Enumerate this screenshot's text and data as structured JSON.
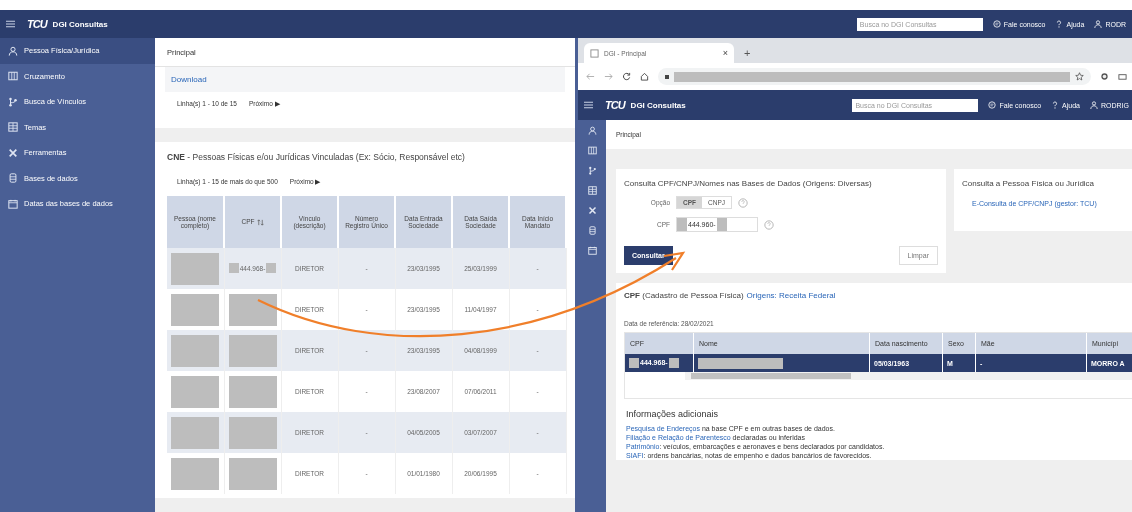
{
  "topbar": {
    "logo": "TCU",
    "app_title": "DGI Consultas",
    "search": {
      "placeholder": "Busca no DGI Consultas"
    },
    "links": [
      {
        "kind": "contact",
        "label": "Fale conosco"
      },
      {
        "kind": "help",
        "label": "Ajuda"
      },
      {
        "kind": "user",
        "label": "RODR"
      }
    ]
  },
  "sidebar": {
    "items": [
      {
        "label": "Pessoa Física/Jurídica",
        "selected": true
      },
      {
        "label": "Cruzamento",
        "selected": false
      },
      {
        "label": "Busca de Vínculos",
        "selected": false
      },
      {
        "label": "Temas",
        "selected": false
      },
      {
        "label": "Ferramentas",
        "selected": false
      },
      {
        "label": "Bases de dados",
        "selected": false
      },
      {
        "label": "Datas das bases de dados",
        "selected": false
      }
    ]
  },
  "main": {
    "breadcrumb": "Principal",
    "download": "Download",
    "pagination": {
      "text": "Linha(s) 1 - 10 de 15",
      "next": "Próximo ▶"
    },
    "cne": {
      "title": "**CNE** - Pessoas Físicas e/ou Jurídicas Vinculadas (Ex: Sócio, Responsável etc)",
      "pagination": {
        "text": "Linha(s) 1 - 15 de mais do que 500",
        "next": "Próximo ▶"
      },
      "columns": [
        {
          "label": "Pessoa (nome completo)",
          "sortable": false
        },
        {
          "label": "CPF",
          "sortable": true
        },
        {
          "label": "Vínculo (descrição)",
          "sortable": false
        },
        {
          "label": "Número Registro Único",
          "sortable": false
        },
        {
          "label": "Data Entrada Sociedade",
          "sortable": false
        },
        {
          "label": "Data Saída Sociedade",
          "sortable": false
        },
        {
          "label": "Data Início Mandato",
          "sortable": false
        }
      ],
      "rows": [
        {
          "cells": [
            {
              "kind": "redacted"
            },
            {
              "kind": "partial",
              "text": "444.968-"
            },
            {
              "kind": "text",
              "text": "DIRETOR"
            },
            {
              "kind": "text",
              "text": "-"
            },
            {
              "kind": "text",
              "text": "23/03/1995"
            },
            {
              "kind": "text",
              "text": "25/03/1999"
            },
            {
              "kind": "text",
              "text": "-"
            }
          ]
        },
        {
          "cells": [
            {
              "kind": "redacted"
            },
            {
              "kind": "redacted"
            },
            {
              "kind": "text",
              "text": "DIRETOR"
            },
            {
              "kind": "text",
              "text": "-"
            },
            {
              "kind": "text",
              "text": "23/03/1995"
            },
            {
              "kind": "text",
              "text": "11/04/1997"
            },
            {
              "kind": "text",
              "text": "-"
            }
          ]
        },
        {
          "cells": [
            {
              "kind": "redacted"
            },
            {
              "kind": "redacted"
            },
            {
              "kind": "text",
              "text": "DIRETOR"
            },
            {
              "kind": "text",
              "text": "-"
            },
            {
              "kind": "text",
              "text": "23/03/1995"
            },
            {
              "kind": "text",
              "text": "04/08/1999"
            },
            {
              "kind": "text",
              "text": "-"
            }
          ]
        },
        {
          "cells": [
            {
              "kind": "redacted"
            },
            {
              "kind": "redacted"
            },
            {
              "kind": "text",
              "text": "DIRETOR"
            },
            {
              "kind": "text",
              "text": "-"
            },
            {
              "kind": "text",
              "text": "23/08/2007"
            },
            {
              "kind": "text",
              "text": "07/06/2011"
            },
            {
              "kind": "text",
              "text": "-"
            }
          ]
        },
        {
          "cells": [
            {
              "kind": "redacted"
            },
            {
              "kind": "redacted"
            },
            {
              "kind": "text",
              "text": "DIRETOR"
            },
            {
              "kind": "text",
              "text": "-"
            },
            {
              "kind": "text",
              "text": "04/05/2005"
            },
            {
              "kind": "text",
              "text": "03/07/2007"
            },
            {
              "kind": "text",
              "text": "-"
            }
          ]
        },
        {
          "cells": [
            {
              "kind": "redacted"
            },
            {
              "kind": "redacted"
            },
            {
              "kind": "text",
              "text": "DIRETOR"
            },
            {
              "kind": "text",
              "text": "-"
            },
            {
              "kind": "text",
              "text": "01/01/1980"
            },
            {
              "kind": "text",
              "text": "20/06/1995"
            },
            {
              "kind": "text",
              "text": "-"
            }
          ]
        }
      ]
    }
  },
  "browser": {
    "tab": {
      "title": "DGI - Principal",
      "close": "×"
    },
    "new_tab": "+",
    "app": {
      "header": {
        "logo": "TCU",
        "app_title": "DGI Consultas",
        "search": {
          "placeholder": "Busca no DGI Consultas"
        },
        "links": [
          {
            "kind": "contact",
            "label": "Fale conosco"
          },
          {
            "kind": "help",
            "label": "Ajuda"
          },
          {
            "kind": "user",
            "label": "RODRIG"
          }
        ]
      },
      "breadcrumb": "Principal",
      "consulta": {
        "title": "Consulta CPF/CNPJ/Nomes nas Bases de Dados (Origens: Diversas)",
        "option_label": "Opção",
        "options": [
          {
            "label": "CPF",
            "selected": true
          },
          {
            "label": "CNPJ",
            "selected": false
          }
        ],
        "cpf_label": "CPF",
        "cpf_value": "444.960-",
        "submit": "Consultar",
        "clear": "Limpar"
      },
      "pessoa": {
        "title": "Consulta a Pessoa Física ou Jurídica",
        "link": "E-Consulta de CPF/CNPJ (gestor: TCU)"
      },
      "cpf": {
        "title": "**CPF** (Cadastro de Pessoa Física)",
        "origin": "Origens: Receita Federal",
        "reference": "Data de referência: 28/02/2021",
        "columns": [
          "CPF",
          "Nome",
          "Data nascimento",
          "Sexo",
          "Mãe",
          "Municípi"
        ],
        "rows": [
          {
            "selected": true,
            "cells": [
              {
                "kind": "partial",
                "text": "444.968-"
              },
              {
                "kind": "redacted"
              },
              {
                "kind": "text",
                "text": "05/03/1963"
              },
              {
                "kind": "text",
                "text": "M"
              },
              {
                "kind": "text",
                "text": "-"
              },
              {
                "kind": "text",
                "text": "MORRO A"
              }
            ]
          }
        ]
      },
      "info": {
        "title": "Informações adicionais",
        "lines": [
          {
            "link": "Pesquisa de Endereços",
            "text": " na base CPF e em outras bases de dados."
          },
          {
            "link": "Filiação e Relação de Parentesco",
            "text": " declaradas ou inferidas"
          },
          {
            "link": "Patrimônio",
            "text": ": veículos, embarcações e aeronaves e bens declarados por candidatos."
          },
          {
            "link": "SIAFI",
            "text": ": ordens bancárias, notas de empenho e dados bancários de favorecidos."
          }
        ]
      }
    }
  }
}
